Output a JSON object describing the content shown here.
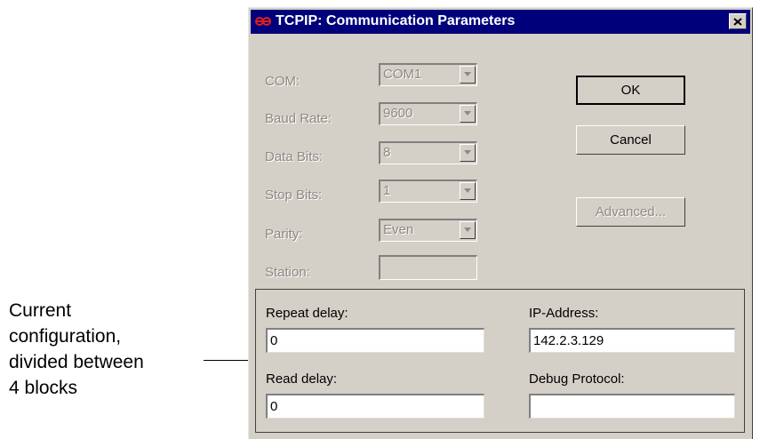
{
  "annotation": {
    "text": "Current\nconfiguration,\ndivided between\n4 blocks"
  },
  "window": {
    "title": "TCPIP: Communication Parameters",
    "close_label": "×"
  },
  "serial_settings": {
    "com": {
      "label": "COM:",
      "value": "COM1"
    },
    "baud_rate": {
      "label": "Baud Rate:",
      "value": "9600"
    },
    "data_bits": {
      "label": "Data Bits:",
      "value": "8"
    },
    "stop_bits": {
      "label": "Stop Bits:",
      "value": "1"
    },
    "parity": {
      "label": "Parity:",
      "value": "Even"
    },
    "station": {
      "label": "Station:",
      "value": ""
    }
  },
  "buttons": {
    "ok": "OK",
    "cancel": "Cancel",
    "advanced": "Advanced..."
  },
  "configuration": {
    "repeat_delay": {
      "label": "Repeat delay:",
      "value": "0"
    },
    "ip_address": {
      "label": "IP-Address:",
      "value": "142.2.3.129"
    },
    "read_delay": {
      "label": "Read delay:",
      "value": "0"
    },
    "debug_protocol": {
      "label": "Debug Protocol:",
      "value": ""
    }
  },
  "colors": {
    "titlebar": "#00007b",
    "dialog_face": "#d4d0c8",
    "disabled_text": "#8c8a84",
    "title_icon": "#e0201a"
  },
  "icons": {
    "title_icon": "red-link-icon",
    "close_icon": "close-icon",
    "dropdown_icon": "chevron-down-icon"
  }
}
